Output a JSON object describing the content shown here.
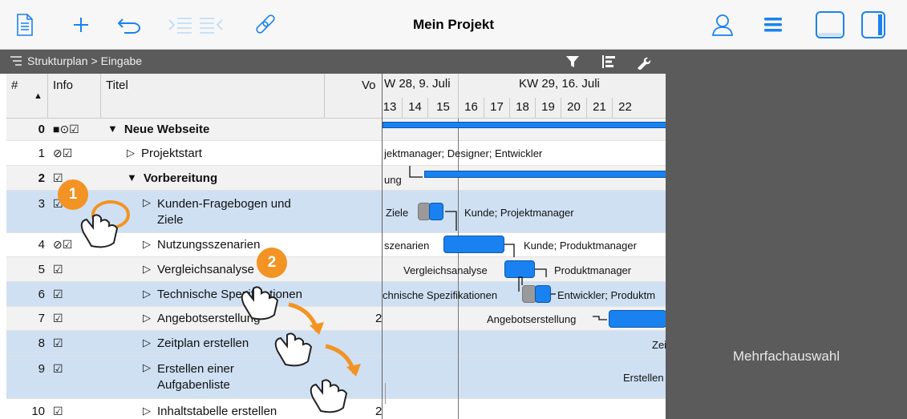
{
  "toolbar": {
    "title": "Mein Projekt"
  },
  "subbar": {
    "crumb_root": "Strukturplan",
    "crumb_current": "Eingabe"
  },
  "right_panel": {
    "label": "Mehrfachauswahl"
  },
  "columns": {
    "num": "#",
    "info": "Info",
    "title": "Titel",
    "vo": "Vo"
  },
  "gantt": {
    "weeks": [
      "W 28, 9. Juli",
      "KW 29, 16. Juli"
    ],
    "days": [
      "13",
      "14",
      "15",
      "16",
      "17",
      "18",
      "19",
      "20",
      "21",
      "22"
    ],
    "labels": {
      "r1": "jektmanager; Designer; Entwickler",
      "r2": "ung",
      "r3a": "Ziele",
      "r3b": "Kunde; Projektmanager",
      "r4a": "szenarien",
      "r4b": "Kunde; Produktmanager",
      "r5a": "Vergleichsanalyse",
      "r5b": "Produktmanager",
      "r6a": "chnische Spezifikationen",
      "r6b": "Entwickler; Produktm",
      "r7a": "Angebotserstellung",
      "r8": "Zei",
      "r9": "Erstellen"
    }
  },
  "rows": [
    {
      "num": "0",
      "info": "■⊙☑",
      "title": "Neue Webseite"
    },
    {
      "num": "1",
      "info": "⊘☑",
      "title": "Projektstart"
    },
    {
      "num": "2",
      "info": "☑",
      "title": "Vorbereitung"
    },
    {
      "num": "3",
      "info": "☑",
      "title": "Kunden-Fragebogen und",
      "title2": "Ziele"
    },
    {
      "num": "4",
      "info": "⊘☑",
      "title": "Nutzungsszenarien"
    },
    {
      "num": "5",
      "info": "☑",
      "title": "Vergleichsanalyse"
    },
    {
      "num": "6",
      "info": "☑",
      "title": "Technische Spezifikationen"
    },
    {
      "num": "7",
      "info": "☑",
      "title": "Angebotserstellung",
      "vo": "2"
    },
    {
      "num": "8",
      "info": "☑",
      "title": "Zeitplan erstellen"
    },
    {
      "num": "9",
      "info": "☑",
      "title": "Erstellen einer",
      "title2": "Aufgabenliste"
    },
    {
      "num": "10",
      "info": "☑",
      "title": "Inhaltstabelle erstellen",
      "vo": "2"
    }
  ],
  "badges": [
    "1",
    "2"
  ],
  "colors": {
    "accent": "#1a82f0",
    "badge": "#f39323",
    "selection": "#cfe0f3",
    "dark": "#5b5b5b"
  },
  "icons": [
    "document-icon",
    "plus-icon",
    "undo-icon",
    "indent-icon",
    "outdent-icon",
    "link-icon",
    "person-icon",
    "menu-icon",
    "panel-bottom-icon",
    "panel-right-icon",
    "filter-icon",
    "align-icon",
    "wrench-icon",
    "hand-pointer-icon"
  ]
}
